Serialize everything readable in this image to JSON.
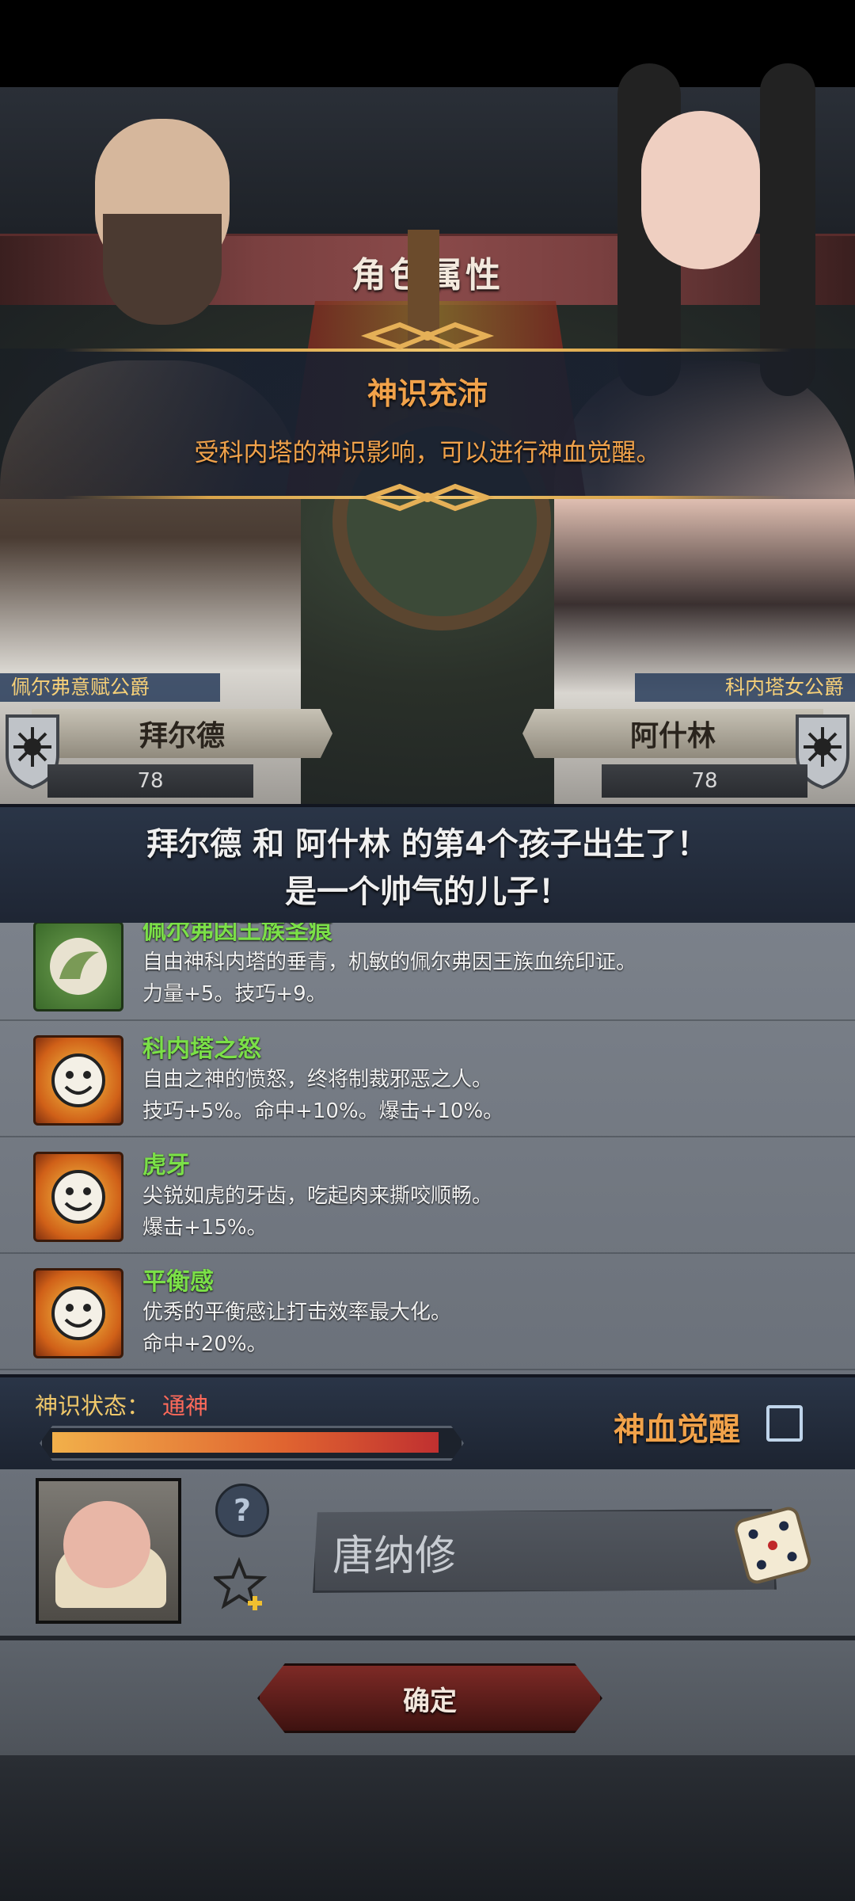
{
  "header": {
    "title": "角色属性"
  },
  "notice": {
    "title": "神识充沛",
    "description": "受科内塔的神识影响，可以进行神血觉醒。"
  },
  "parents": {
    "left": {
      "title": "佩尔弗意赋公爵",
      "name": "拜尔德",
      "level": "78"
    },
    "right": {
      "title": "科内塔女公爵",
      "name": "阿什林",
      "level": "78"
    }
  },
  "birth": {
    "line1": "拜尔德 和 阿什林 的第4个孩子出生了！",
    "line2": "是一个帅气的儿子！"
  },
  "traits": [
    {
      "name": "佩尔弗因王族圣痕",
      "description": "自由神科内塔的垂青，机敏的佩尔弗因王族血统印证。",
      "stats": "力量+5。技巧+9。",
      "icon": "leaf-emblem-icon"
    },
    {
      "name": "科内塔之怒",
      "description": "自由之神的愤怒，终将制裁邪恶之人。",
      "stats": "技巧+5%。命中+10%。爆击+10%。",
      "icon": "smiley-sun-icon"
    },
    {
      "name": "虎牙",
      "description": "尖锐如虎的牙齿，吃起肉来撕咬顺畅。",
      "stats": "爆击+15%。",
      "icon": "smiley-sun-icon"
    },
    {
      "name": "平衡感",
      "description": "优秀的平衡感让打击效率最大化。",
      "stats": "命中+20%。",
      "icon": "smiley-sun-icon"
    }
  ],
  "divine_status": {
    "label": "神识状态：",
    "value": "通神",
    "progress": 0.98,
    "awaken_label": "神血觉醒",
    "awaken_checked": false
  },
  "child": {
    "name": "唐纳修"
  },
  "footer": {
    "confirm_label": "确定"
  },
  "colors": {
    "accent": "#f1a24a",
    "trait_name": "#7be048",
    "status_value": "#ff6a5a",
    "banner": "#8a4a4a"
  }
}
